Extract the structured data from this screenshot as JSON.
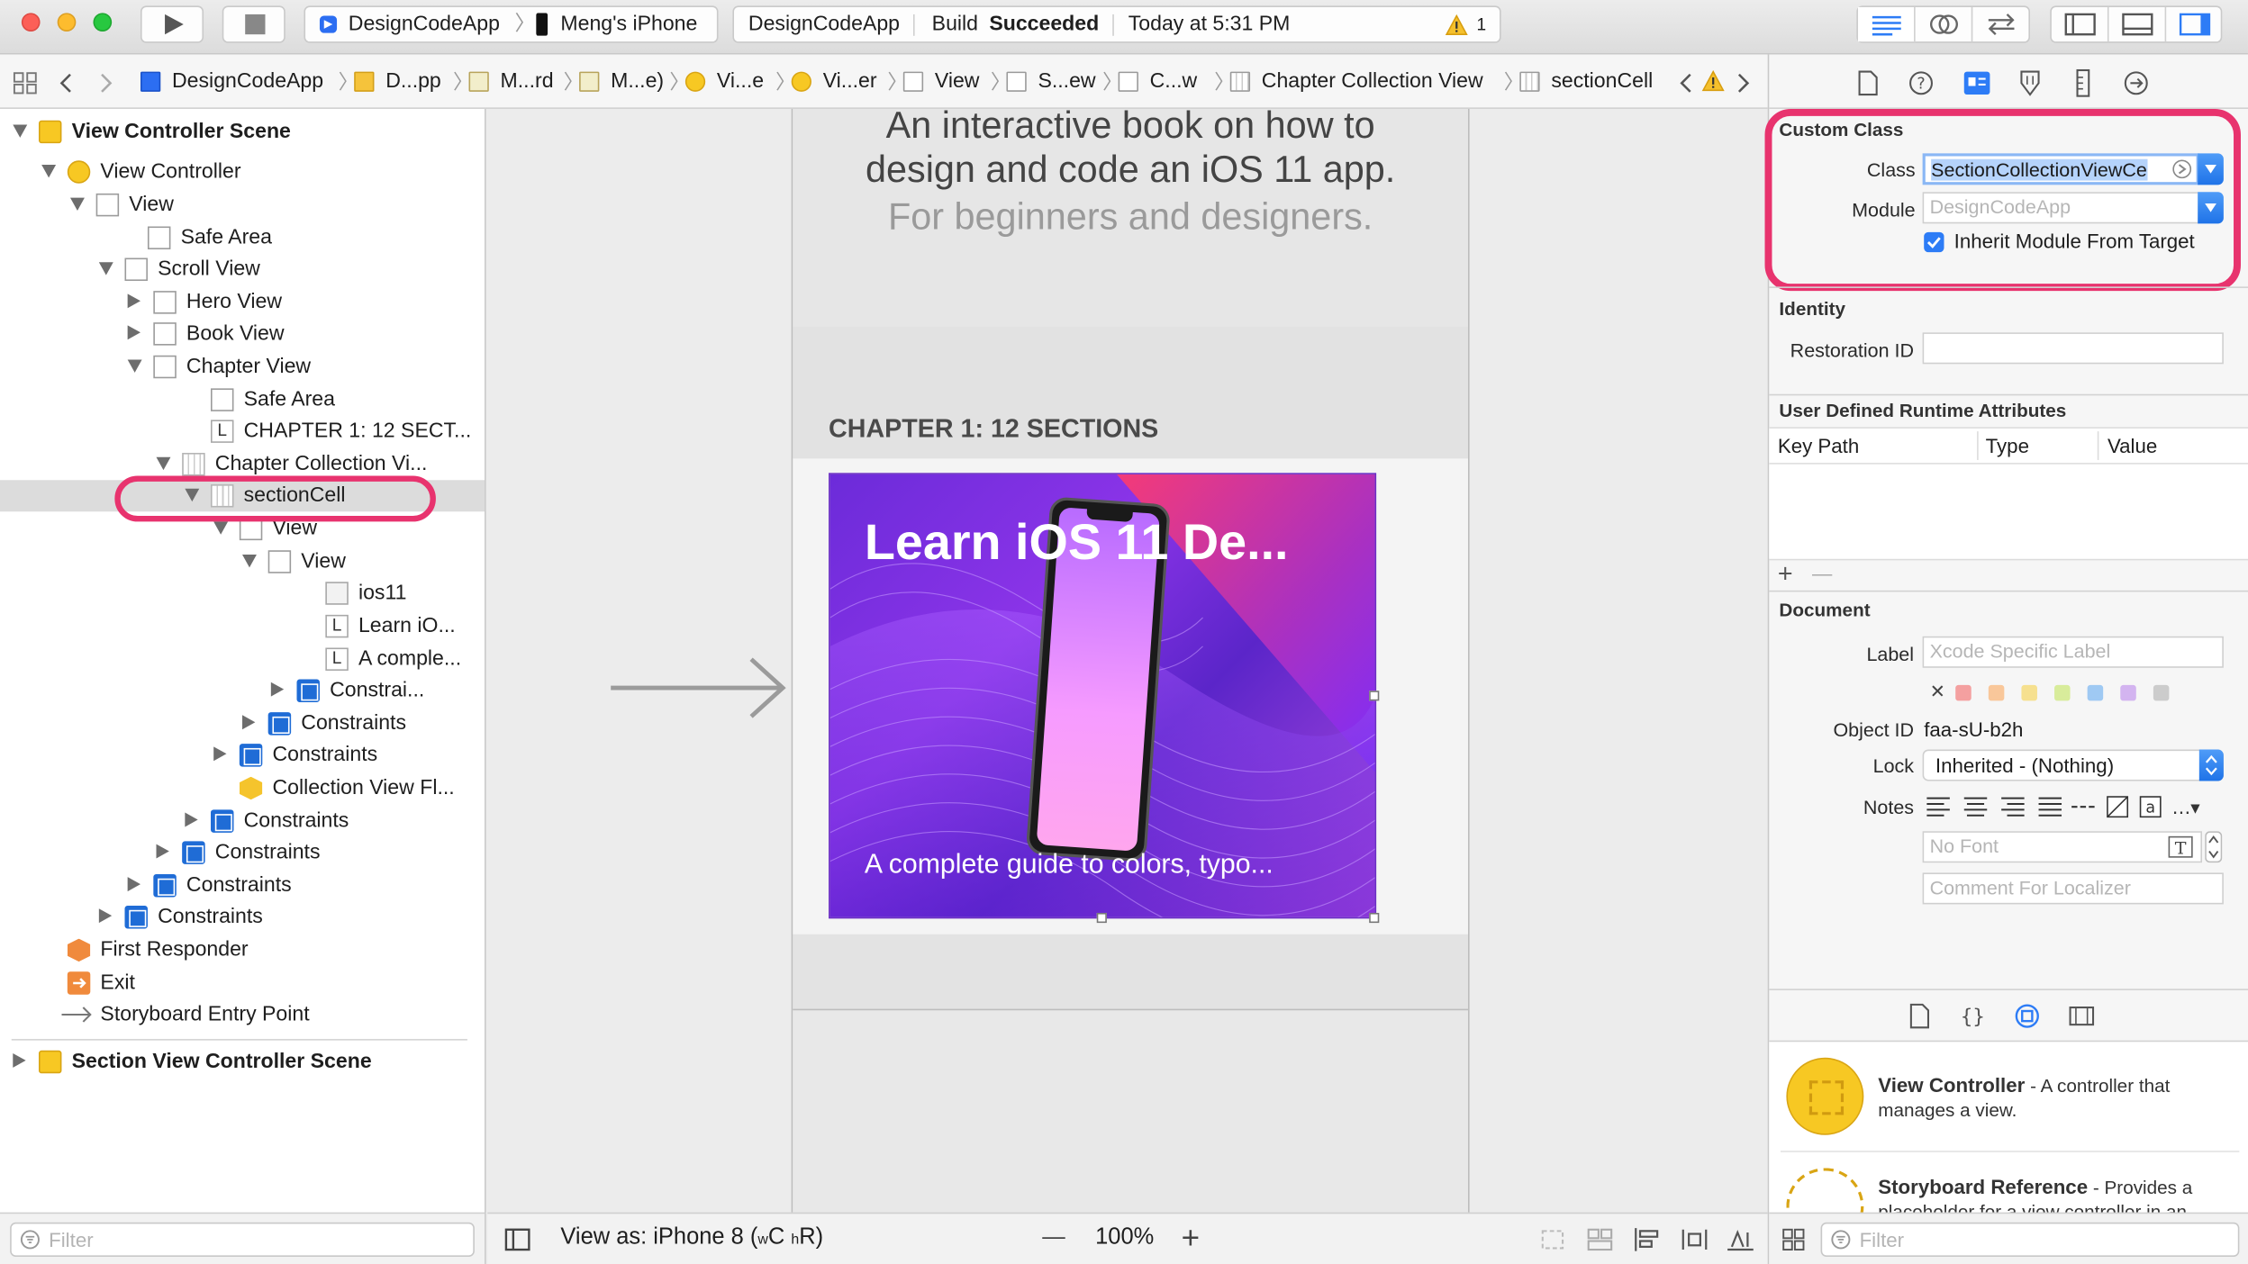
{
  "toolbar": {
    "scheme": "DesignCodeApp",
    "device": "Meng's iPhone",
    "status_project": "DesignCodeApp",
    "status_build_prefix": "Build",
    "status_build_result": "Succeeded",
    "status_time": "Today at 5:31 PM",
    "warning_count": "1"
  },
  "breadcrumb": [
    "DesignCodeApp",
    "D...pp",
    "M...rd",
    "M...e)",
    "Vi...e",
    "Vi...er",
    "View",
    "S...ew",
    "C...w",
    "Chapter Collection View",
    "sectionCell"
  ],
  "navigator": {
    "rows": [
      {
        "label": "View Controller Scene"
      },
      {
        "label": "View Controller"
      },
      {
        "label": "View"
      },
      {
        "label": "Safe Area"
      },
      {
        "label": "Scroll View"
      },
      {
        "label": "Hero View"
      },
      {
        "label": "Book View"
      },
      {
        "label": "Chapter View"
      },
      {
        "label": "Safe Area"
      },
      {
        "label": "CHAPTER 1: 12 SECT..."
      },
      {
        "label": "Chapter Collection Vi..."
      },
      {
        "label": "sectionCell"
      },
      {
        "label": "View"
      },
      {
        "label": "View"
      },
      {
        "label": "ios11"
      },
      {
        "label": "Learn iO..."
      },
      {
        "label": "A comple..."
      },
      {
        "label": "Constrai..."
      },
      {
        "label": "Constraints"
      },
      {
        "label": "Constraints"
      },
      {
        "label": "Collection View Fl..."
      },
      {
        "label": "Constraints"
      },
      {
        "label": "Constraints"
      },
      {
        "label": "Constraints"
      },
      {
        "label": "Constraints"
      },
      {
        "label": "First Responder"
      },
      {
        "label": "Exit"
      },
      {
        "label": "Storyboard Entry Point"
      },
      {
        "label": "Section View Controller Scene"
      }
    ],
    "filter_placeholder": "Filter"
  },
  "canvas": {
    "hero_line1": "An interactive book on how to",
    "hero_line2": "design and code an iOS 11 app.",
    "hero_line3": "For beginners and designers.",
    "chapter_title": "CHAPTER 1: 12 SECTIONS",
    "cell_title": "Learn iOS 11 De...",
    "cell_caption": "A complete guide to colors, typo...",
    "view_as": "View as: iPhone 8",
    "size_class_w": "w",
    "size_class_c": "C",
    "size_class_h": "h",
    "size_class_r": "R",
    "zoom_minus": "—",
    "zoom": "100%",
    "zoom_plus": "+"
  },
  "inspector": {
    "custom_class_header": "Custom Class",
    "class_label": "Class",
    "class_value": "SectionCollectionViewCe",
    "module_label": "Module",
    "module_placeholder": "DesignCodeApp",
    "inherit_label": "Inherit Module From Target",
    "identity_header": "Identity",
    "restoration_label": "Restoration ID",
    "udra_header": "User Defined Runtime Attributes",
    "col_keypath": "Key Path",
    "col_type": "Type",
    "col_value": "Value",
    "add_symbol": "+",
    "remove_symbol": "—",
    "document_header": "Document",
    "label_label": "Label",
    "label_placeholder": "Xcode Specific Label",
    "swatch_x": "✕",
    "object_id_label": "Object ID",
    "object_id_value": "faa-sU-b2h",
    "lock_label": "Lock",
    "lock_value": "Inherited - (Nothing)",
    "notes_label": "Notes",
    "font_placeholder": "No Font",
    "comment_placeholder": "Comment For Localizer",
    "library_title": "View Controller",
    "library_desc": " - A controller that manages a view.",
    "library_title2": "Storyboard Reference",
    "library_desc2": " - Provides a placeholder for a view controller in an",
    "filter_placeholder": "Filter"
  },
  "colors": {
    "highlight": "#e8336e",
    "selection": "#2d7cf6",
    "accent_blue": "#1f73e8"
  }
}
